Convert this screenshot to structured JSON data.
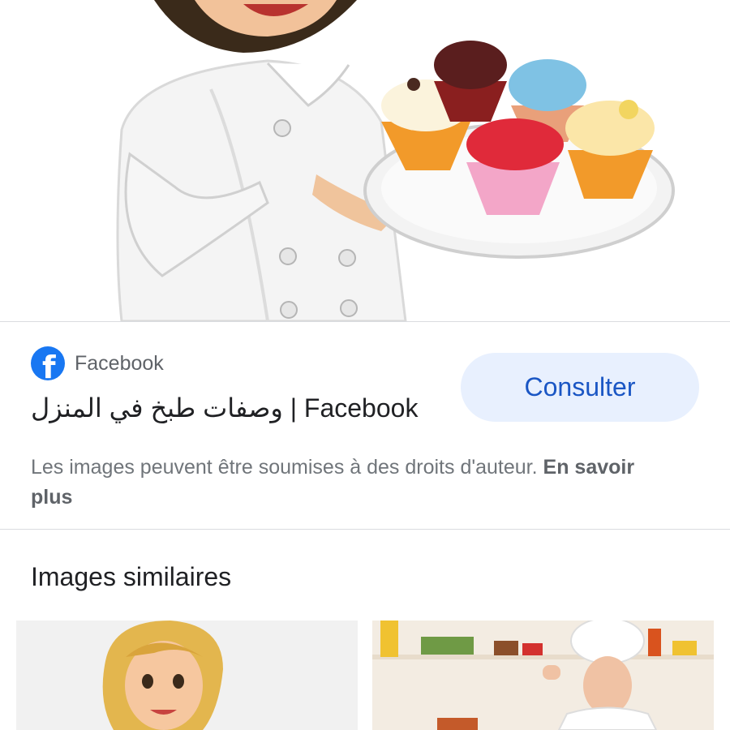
{
  "result": {
    "source_name": "Facebook",
    "source_icon": "facebook-icon",
    "title": "وصفات طبخ في المنزل | Facebook",
    "consult_label": "Consulter"
  },
  "copyright": {
    "text": "Les images peuvent être soumises à des droits d'auteur.",
    "link": "En savoir plus"
  },
  "similar": {
    "title": "Images similaires"
  },
  "colors": {
    "facebook_blue": "#1877f2",
    "button_bg": "#e8f0fe",
    "button_text": "#1a56c4"
  }
}
